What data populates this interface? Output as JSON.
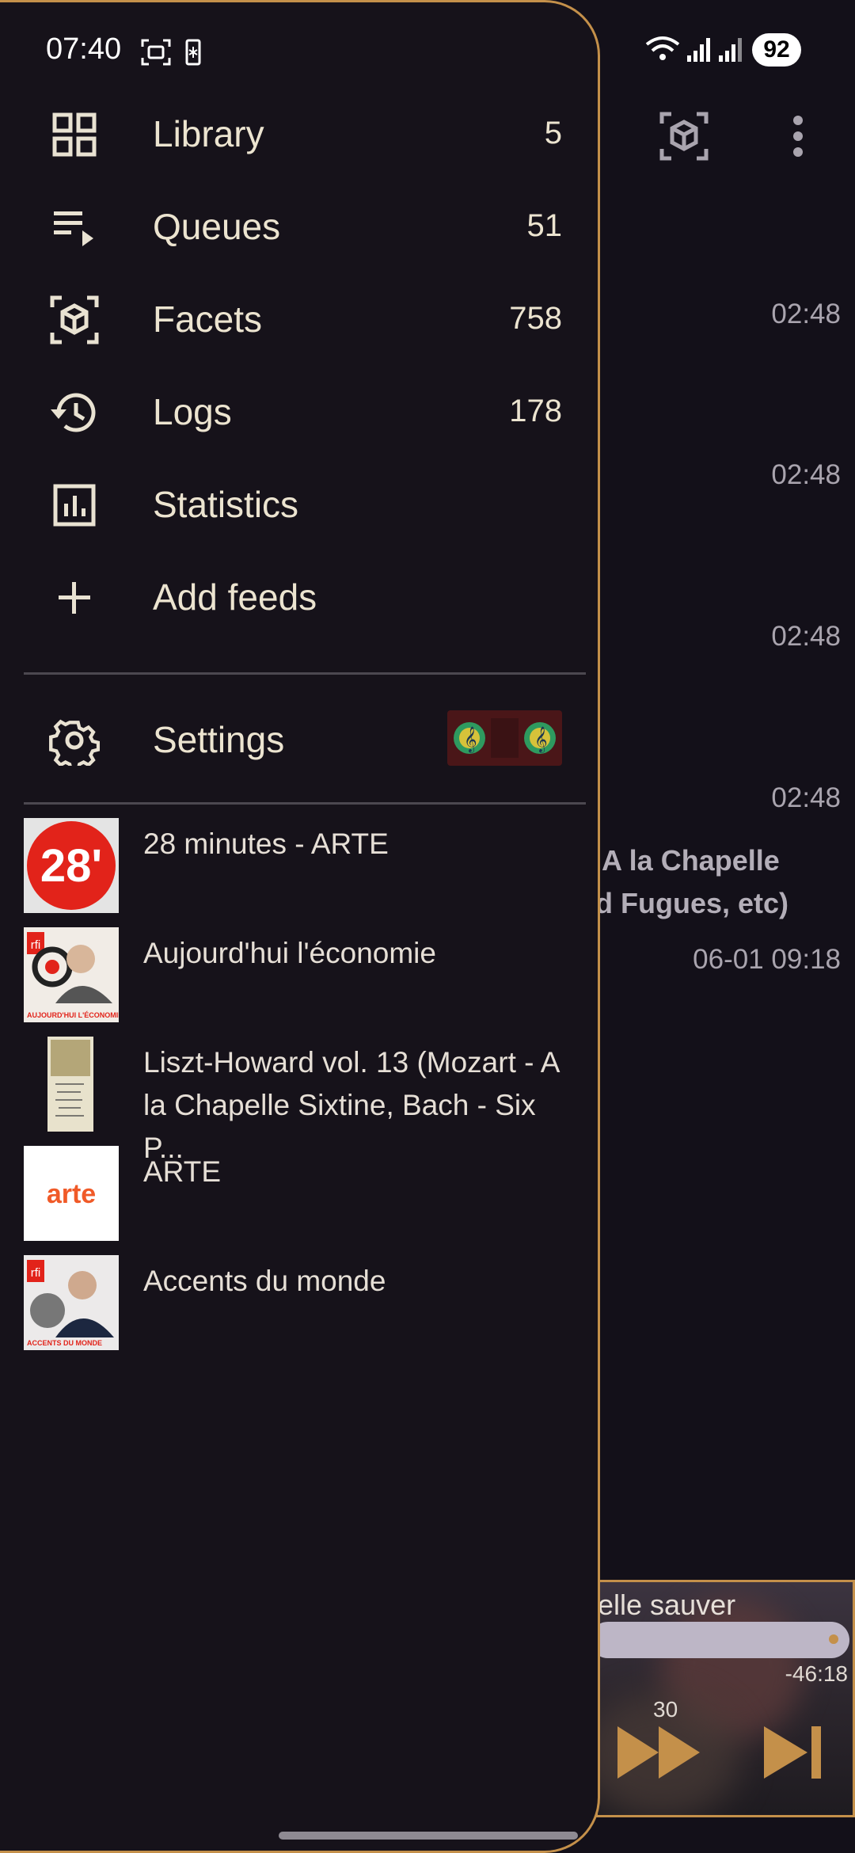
{
  "status_bar": {
    "time": "07:40",
    "battery": "92"
  },
  "drawer": {
    "nav_items": [
      {
        "label": "Library",
        "count": "5",
        "icon": "grid-icon"
      },
      {
        "label": "Queues",
        "count": "51",
        "icon": "queue-icon"
      },
      {
        "label": "Facets",
        "count": "758",
        "icon": "facets-icon"
      },
      {
        "label": "Logs",
        "count": "178",
        "icon": "history-icon"
      },
      {
        "label": "Statistics",
        "count": "",
        "icon": "statistics-icon"
      },
      {
        "label": "Add feeds",
        "count": "",
        "icon": "plus-icon"
      }
    ],
    "settings": {
      "label": "Settings",
      "icon": "gear-icon"
    },
    "feeds": [
      {
        "title": "28 minutes - ARTE",
        "badge": "28'"
      },
      {
        "title": "Aujourd'hui l'économie",
        "badge": "rfi",
        "caption": "AUJOURD'HUI L'ÉCONOMIE"
      },
      {
        "title": "Liszt-Howard vol. 13 (Mozart - A la Chapelle Sixtine, Bach - Six P..."
      },
      {
        "title": "ARTE",
        "badge": "arte"
      },
      {
        "title": "Accents du monde",
        "badge": "rfi",
        "caption": "ACCENTS DU MONDE"
      }
    ]
  },
  "background": {
    "times": [
      "02:48",
      "02:48",
      "02:48",
      "02:48"
    ],
    "title_line1": "A la Chapelle",
    "title_line2": "d Fugues, etc)",
    "date": "06-01 09:18",
    "player": {
      "title": "elle sauver",
      "remaining": "-46:18",
      "skip_seconds": "30"
    }
  },
  "colors": {
    "accent": "#c4904a",
    "background": "#131019",
    "text": "#ece4d0"
  }
}
